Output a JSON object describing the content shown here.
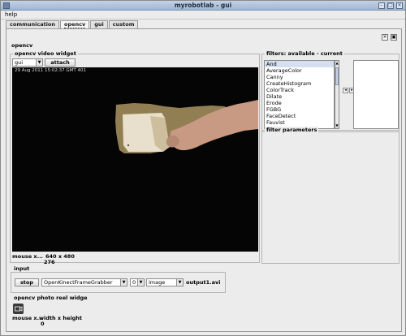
{
  "window": {
    "title": "myrobotlab - gui"
  },
  "menu": {
    "help": "help"
  },
  "tabs": [
    {
      "label": "communication"
    },
    {
      "label": "opencv"
    },
    {
      "label": "gui"
    },
    {
      "label": "custom"
    }
  ],
  "panel": {
    "title": "opencv",
    "video_widget": {
      "title": "opencv  video widget",
      "source_select": "gui",
      "attach_label": "attach",
      "timestamp": "29 Aug 2011 15:02:37 GMT 401",
      "mouse_label": "mouse x...",
      "resolution": "640 x 480",
      "frame_count": "276"
    },
    "filters": {
      "title": "filters: available - current",
      "available": [
        "And",
        "AverageColor",
        "Canny",
        "CreateHistogram",
        "ColorTrack",
        "Dilate",
        "Erode",
        "FGBG",
        "FaceDetect",
        "Fauvist"
      ],
      "selected_index": 0,
      "add_icon": "arrow-right-icon",
      "remove_icon": "arrow-left-icon"
    },
    "filter_parameters": {
      "title": "filter parameters"
    },
    "input": {
      "title": "input",
      "stop_label": "stop",
      "grabber_select": "OpenKinectFrameGrabber",
      "index_select": "0",
      "type_select": "image",
      "file_name": "output1.avi"
    },
    "photo_reel": {
      "title": "opencv  photo reel widge",
      "mouse_label": "mouse x...",
      "size_label": "width x height",
      "count": "0",
      "icon": "camera-icon"
    }
  }
}
